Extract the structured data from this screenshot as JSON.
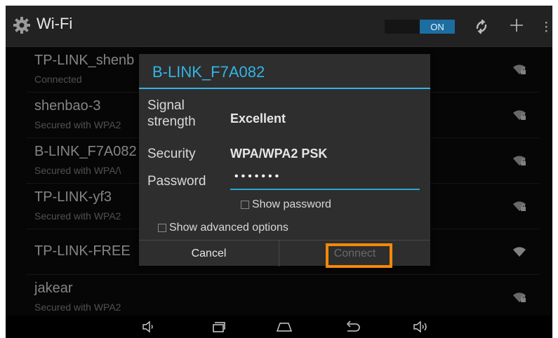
{
  "header": {
    "title": "Wi-Fi",
    "toggle_state": "ON",
    "accent_color": "#33b5e5"
  },
  "networks": [
    {
      "name": "TP-LINK_shenb",
      "status": "Connected",
      "signal_icon": "wifi-lock-icon"
    },
    {
      "name": "shenbao-3",
      "status": "Secured with WPA2",
      "signal_icon": "wifi-lock-icon"
    },
    {
      "name": "B-LINK_F7A082",
      "status": "Secured with WPA/\\",
      "signal_icon": "wifi-lock-icon"
    },
    {
      "name": "TP-LINK-yf3",
      "status": "Secured with WPA2",
      "signal_icon": "wifi-lock-icon"
    },
    {
      "name": "TP-LINK-FREE",
      "status": "",
      "signal_icon": "wifi-icon"
    },
    {
      "name": "jakear",
      "status": "Secured with WPA2",
      "signal_icon": "wifi-lock-icon"
    }
  ],
  "dialog": {
    "title": "B-LINK_F7A082",
    "signal_label_line1": "Signal",
    "signal_label_line2": "strength",
    "signal_value": "Excellent",
    "security_label": "Security",
    "security_value": "WPA/WPA2 PSK",
    "password_label": "Password",
    "password_value": "•••••••",
    "show_password_label": "Show password",
    "show_password_checked": false,
    "advanced_label": "Show advanced options",
    "advanced_checked": false,
    "cancel_label": "Cancel",
    "connect_label": "Connect",
    "highlight_color": "#f2890a"
  },
  "navbar": {
    "icons": [
      "volume-down-icon",
      "recent-apps-icon",
      "home-icon",
      "back-icon",
      "volume-up-icon"
    ]
  }
}
